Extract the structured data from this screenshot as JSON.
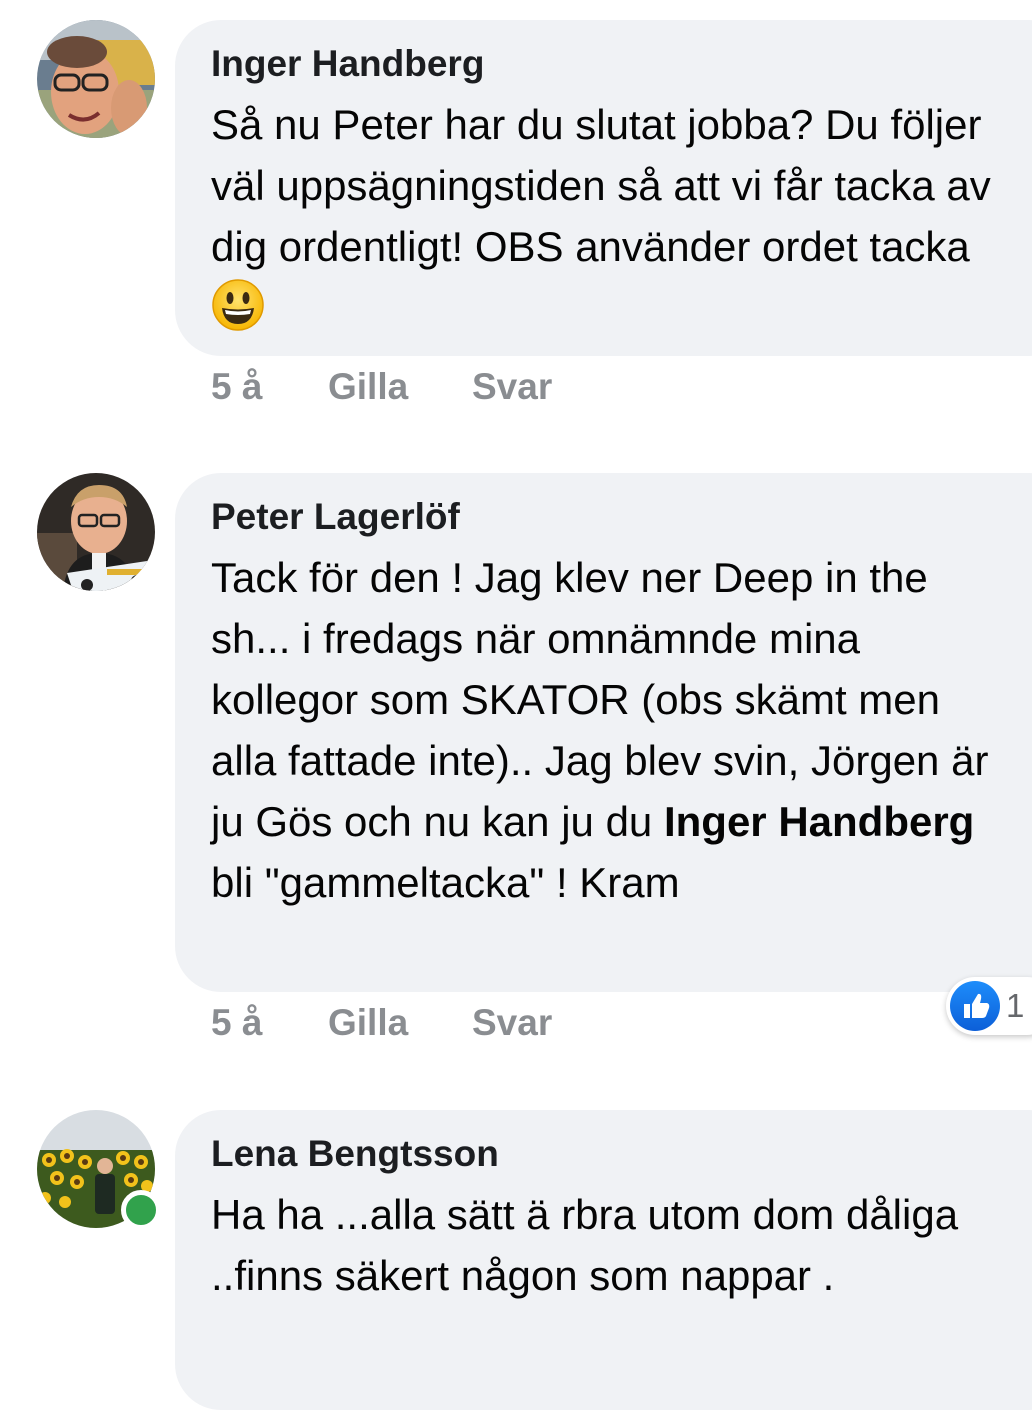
{
  "comments": [
    {
      "author": "Inger Handberg",
      "text": "Så nu Peter har du slutat jobba? Du följer väl uppsägningstiden så att vi får tacka av dig ordentligt! OBS använder ordet tacka",
      "time": "5 å",
      "like_label": "Gilla",
      "reply_label": "Svar"
    },
    {
      "author": "Peter Lagerlöf",
      "text_before": "Tack för den ! Jag klev ner Deep in the sh... i fredags när omnämnde mina kollegor som SKATOR (obs skämt men alla fattade inte).. Jag blev svin, Jörgen är ju Gös och nu kan ju du",
      "mention": "Inger Handberg",
      "text_after": "bli \"gammeltacka\" ! Kram",
      "time": "5 å",
      "like_label": "Gilla",
      "reply_label": "Svar",
      "reaction_count": "1"
    },
    {
      "author": "Lena Bengtsson",
      "text": "Ha ha ...alla sätt ä rbra utom dom dåliga ..finns säkert någon som nappar ."
    }
  ],
  "icons": {
    "emoji": "grinning-face-icon",
    "reaction": "like-thumb-icon",
    "presence": "online-status-dot"
  },
  "colors": {
    "bubble": "#f0f2f5",
    "online": "#31a24c",
    "like_blue": "#1877f2",
    "muted": "#8a8d91"
  }
}
